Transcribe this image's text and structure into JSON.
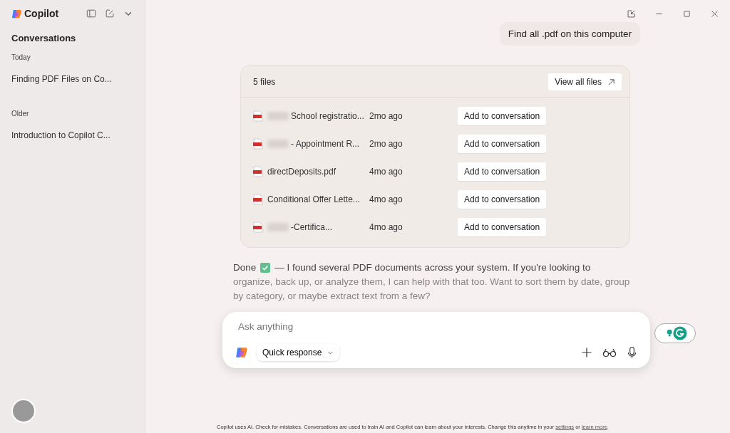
{
  "sidebar": {
    "app_name": "Copilot",
    "heading": "Conversations",
    "groups": [
      {
        "label": "Today",
        "items": [
          {
            "title": "Finding PDF Files on Co...",
            "selected": false
          }
        ]
      },
      {
        "label": "Older",
        "items": [
          {
            "title": "Introduction to Copilot C...",
            "selected": false
          }
        ]
      }
    ]
  },
  "user_message": "Find all .pdf on this computer",
  "files_card": {
    "count": "5 files",
    "view_all": "View all files",
    "files": [
      {
        "name": "School registratio...",
        "redacted": true,
        "age": "2mo ago",
        "action": "Add to conversation"
      },
      {
        "name": "- Appointment R...",
        "redacted": true,
        "age": "2mo ago",
        "action": "Add to conversation"
      },
      {
        "name": "directDeposits.pdf",
        "redacted": false,
        "age": "4mo ago",
        "action": "Add to conversation"
      },
      {
        "name": "Conditional Offer Lette...",
        "redacted": false,
        "age": "4mo ago",
        "action": "Add to conversation"
      },
      {
        "name": "-Certifica...",
        "redacted": true,
        "age": "4mo ago",
        "action": "Add to conversation"
      }
    ]
  },
  "reply": {
    "lead": "Done",
    "first_line": "— I found several PDF documents across your system. If you're looking to",
    "body": "organize, back up, or analyze them, I can help with that too. Want to sort them by date, group by category, or maybe extract text from a few?"
  },
  "composer": {
    "placeholder": "Ask anything",
    "mode": "Quick response"
  },
  "disclaimer": {
    "text": "Copilot uses AI. Check for mistakes. Conversations are used to train AI and Copilot can learn about your interests. Change this anytime in your ",
    "link_1": "settings",
    "joiner": " or ",
    "link_2": "learn more",
    "end": "."
  }
}
